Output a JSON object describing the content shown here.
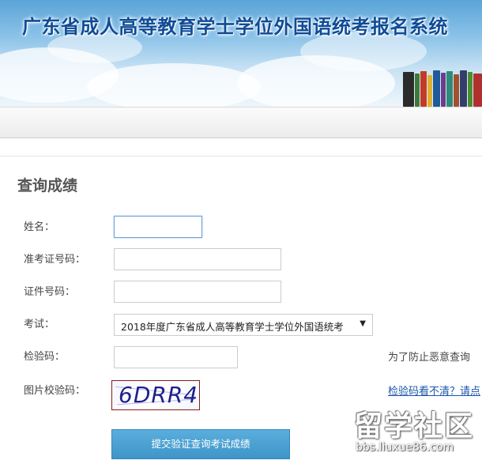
{
  "header": {
    "title": "广东省成人高等教育学士学位外国语统考报名系统"
  },
  "form": {
    "page_title": "查询成绩",
    "name_label": "姓名：",
    "ticket_label": "准考证号码：",
    "id_label": "证件号码：",
    "exam_label": "考试：",
    "exam_selected": "2018年度广东省成人高等教育学士学位外国语统考",
    "code_label": "检验码：",
    "code_hint": "为了防止恶意查询",
    "image_code_label": "图片校验码：",
    "image_code_help": "检验码看不清？请点",
    "captcha_text": "6DRR4",
    "submit_label": "提交验证查询考试成绩"
  },
  "watermark": {
    "big": "留学社区",
    "small": "bbs.liuxue86.com"
  },
  "colors": {
    "title_blue": "#0f4c97",
    "button_blue": "#4aa3d6",
    "link_blue": "#1a56a8"
  }
}
